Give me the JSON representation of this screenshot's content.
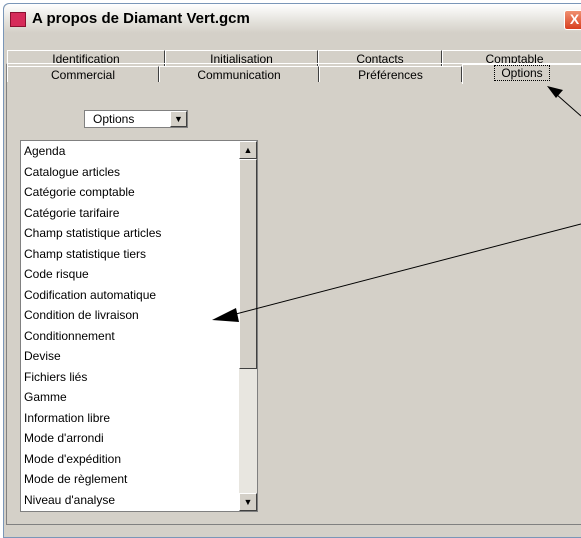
{
  "window": {
    "title": "A propos de Diamant Vert.gcm",
    "close_label": "X"
  },
  "tabs": {
    "row1": [
      "Identification",
      "Initialisation",
      "Contacts",
      "Comptable"
    ],
    "row2": [
      "Commercial",
      "Communication",
      "Préférences",
      "Options"
    ],
    "active": "Options"
  },
  "combo": {
    "value": "Options",
    "icon": "dropdown-arrow-icon"
  },
  "list": {
    "items": [
      "Agenda",
      "Catalogue articles",
      "Catégorie comptable",
      "Catégorie tarifaire",
      "Champ statistique articles",
      "Champ statistique tiers",
      "Code risque",
      "Codification automatique",
      "Condition de livraison",
      "Conditionnement",
      "Devise",
      "Fichiers liés",
      "Gamme",
      "Information libre",
      "Mode d'arrondi",
      "Mode d'expédition",
      "Mode de règlement",
      "Niveau d'analyse"
    ],
    "scroll_position": 0
  },
  "colors": {
    "window_face": "#d4d0c8",
    "close_button": "#d84020",
    "app_icon": "#d62b5a"
  }
}
